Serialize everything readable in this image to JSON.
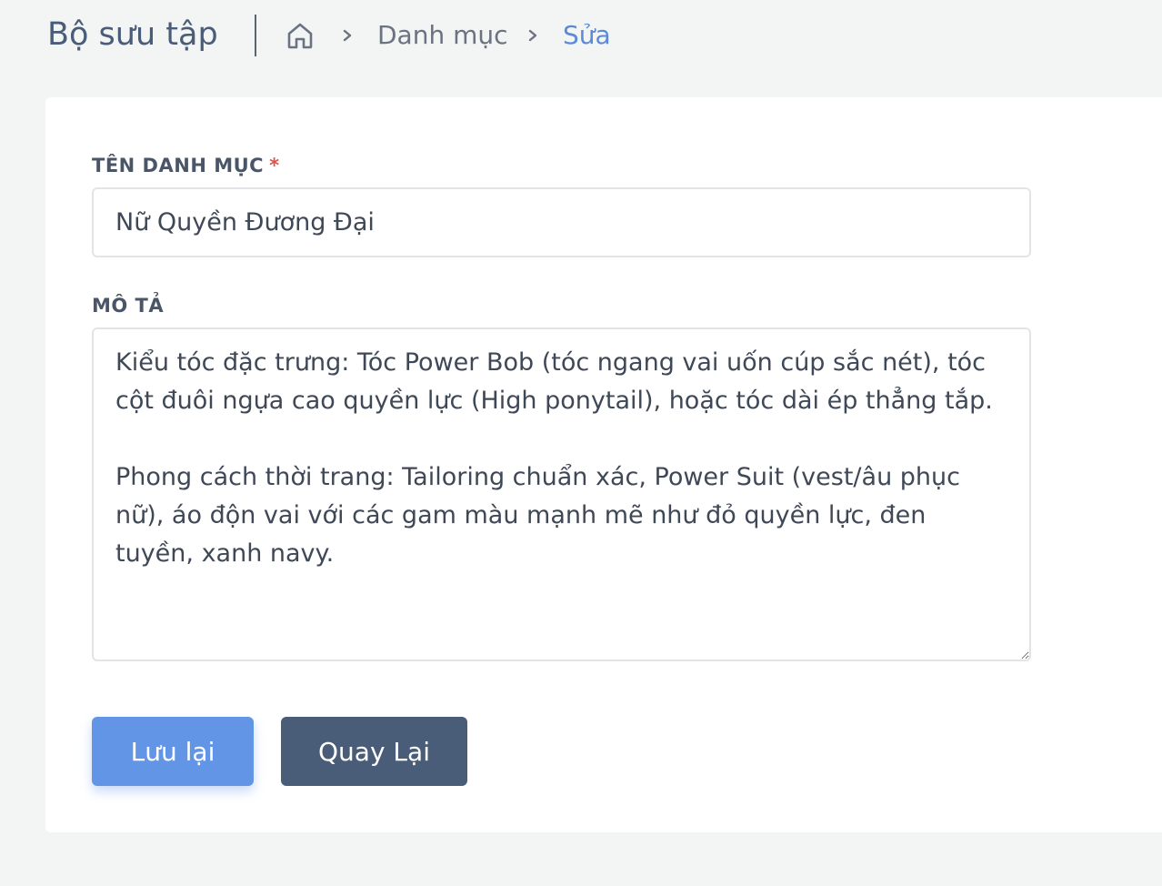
{
  "header": {
    "app_title": "Bộ sưu tập",
    "breadcrumb": {
      "home_icon": "home-icon",
      "separator_icon": "chevron-right-icon",
      "items": [
        {
          "label": "Danh mục"
        },
        {
          "label": "Sửa"
        }
      ]
    }
  },
  "form": {
    "name_field": {
      "label": "TÊN DANH MỤC",
      "required_mark": "*",
      "value": "Nữ Quyền Đương Đại"
    },
    "description_field": {
      "label": "MÔ TẢ",
      "value": "Kiểu tóc đặc trưng: Tóc Power Bob (tóc ngang vai uốn cúp sắc nét), tóc cột đuôi ngựa cao quyền lực (High ponytail), hoặc tóc dài ép thẳng tắp.\n\nPhong cách thời trang: Tailoring chuẩn xác, Power Suit (vest/âu phục nữ), áo độn vai với các gam màu mạnh mẽ như đỏ quyền lực, đen tuyền, xanh navy."
    },
    "buttons": {
      "save_label": "Lưu lại",
      "back_label": "Quay Lại"
    }
  },
  "colors": {
    "accent": "#6395e7",
    "secondary_button": "#4a5d78",
    "active_breadcrumb": "#5b8ad7",
    "required": "#e0524a",
    "page_background": "#f3f4f4"
  }
}
